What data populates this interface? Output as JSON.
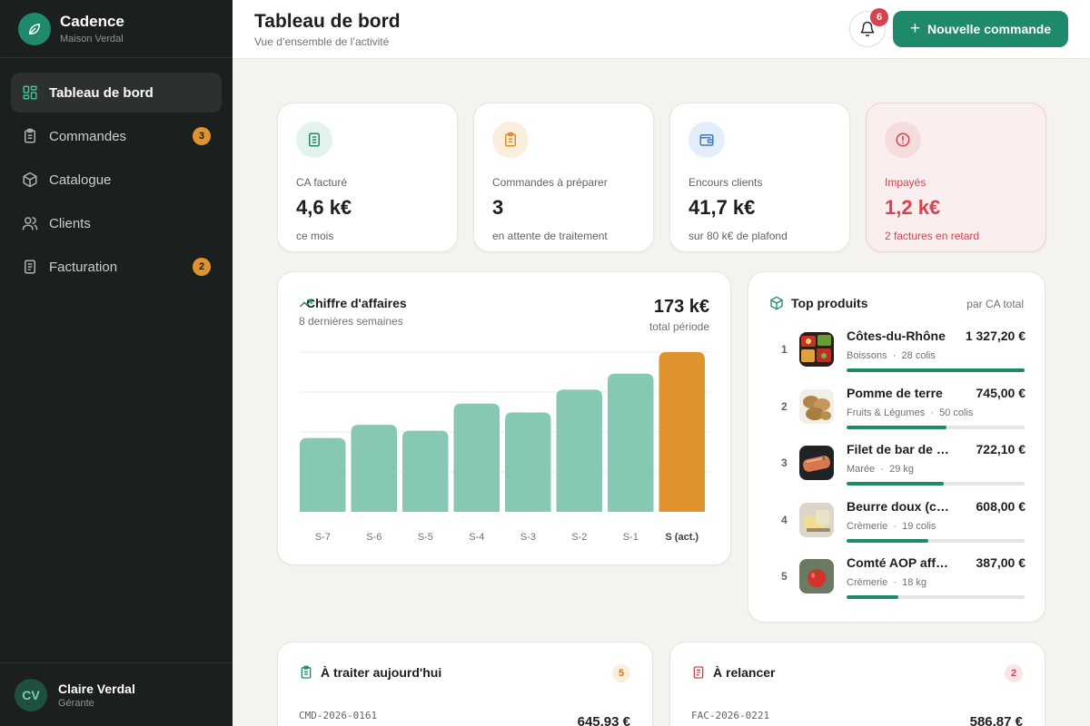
{
  "brand": {
    "name": "Cadence",
    "subtitle": "Maison Verdal",
    "accent": "#1e8a6b"
  },
  "sidebar": {
    "items": [
      {
        "label": "Tableau de bord",
        "icon": "dashboard-icon",
        "active": true,
        "badge": ""
      },
      {
        "label": "Commandes",
        "icon": "clipboard-icon",
        "active": false,
        "badge": "3"
      },
      {
        "label": "Catalogue",
        "icon": "box-icon",
        "active": false,
        "badge": ""
      },
      {
        "label": "Clients",
        "icon": "users-icon",
        "active": false,
        "badge": ""
      },
      {
        "label": "Facturation",
        "icon": "invoice-icon",
        "active": false,
        "badge": "2"
      }
    ]
  },
  "user": {
    "initials": "CV",
    "name": "Claire Verdal",
    "role": "Gérante"
  },
  "header": {
    "title": "Tableau de bord",
    "subtitle": "Vue d’ensemble de l’activité",
    "notifications": "6",
    "new_order_label": "Nouvelle commande"
  },
  "kpis": [
    {
      "label": "CA facturé",
      "value": "4,6 k€",
      "note": "ce mois",
      "icon": "document-icon",
      "color": "#1e8a6b"
    },
    {
      "label": "Commandes à préparer",
      "value": "3",
      "note": "en attente de traitement",
      "icon": "clipboard-icon",
      "color": "#d98a2b"
    },
    {
      "label": "Encours clients",
      "value": "41,7 k€",
      "note": "sur 80 k€ de plafond",
      "icon": "wallet-icon",
      "color": "#3f78c4"
    },
    {
      "label": "Impayés",
      "value": "1,2 k€",
      "note": "2 factures en retard",
      "icon": "alert-icon",
      "color": "#d6434f"
    }
  ],
  "revenue": {
    "title": "Chiffre d'affaires",
    "subtitle": "8 dernières semaines",
    "total": "173 k€",
    "total_label": "total période"
  },
  "chart_data": {
    "type": "bar",
    "categories": [
      "S-7",
      "S-6",
      "S-5",
      "S-4",
      "S-3",
      "S-2",
      "S-1",
      "S (act.)"
    ],
    "values": [
      18.5,
      21.8,
      20.3,
      27.1,
      24.9,
      30.6,
      34.6,
      40.0
    ],
    "ylim": [
      0,
      40
    ],
    "grid": true,
    "highlight_index": 7,
    "colors": {
      "bar": "#86c8b4",
      "highlight": "#e0922f",
      "grid": "#e9e8e3"
    }
  },
  "top_products": {
    "title": "Top produits",
    "meta": "par CA total",
    "items": [
      {
        "rank": "1",
        "name": "Côtes-du-Rhône",
        "amount": "1 327,20 €",
        "category": "Boissons",
        "qty": "28 colis",
        "share": 1.0,
        "thumb": "vegetables-thumbnail"
      },
      {
        "rank": "2",
        "name": "Pomme de terre",
        "amount": "745,00 €",
        "category": "Fruits & Légumes",
        "qty": "50 colis",
        "share": 0.561,
        "thumb": "potatoes-thumbnail"
      },
      {
        "rank": "3",
        "name": "Filet de bar de ligne",
        "amount": "722,10 €",
        "category": "Marée",
        "qty": "29 kg",
        "share": 0.544,
        "thumb": "fish-thumbnail"
      },
      {
        "rank": "4",
        "name": "Beurre doux (colis)",
        "amount": "608,00 €",
        "category": "Crèmerie",
        "qty": "19 colis",
        "share": 0.458,
        "thumb": "butter-thumbnail"
      },
      {
        "rank": "5",
        "name": "Comté AOP affiné",
        "amount": "387,00 €",
        "category": "Crèmerie",
        "qty": "18 kg",
        "share": 0.292,
        "thumb": "tomato-thumbnail"
      }
    ]
  },
  "todo": {
    "title": "À traiter aujourd'hui",
    "count": "5",
    "ref": "CMD-2026-0161",
    "amount": "645,93 €"
  },
  "followup": {
    "title": "À relancer",
    "count": "2",
    "ref": "FAC-2026-0221",
    "amount": "586,87 €"
  }
}
